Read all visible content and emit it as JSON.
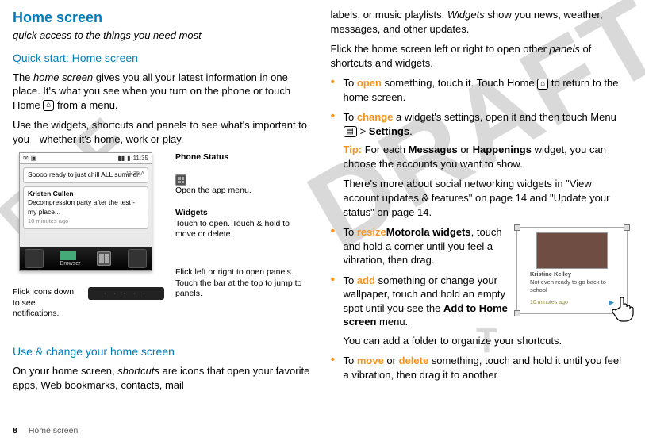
{
  "left": {
    "title": "Home screen",
    "subtitle": "quick access to the things you need most",
    "section1": "Quick start: Home screen",
    "p1a": "The ",
    "p1em": "home screen",
    "p1b": " gives you all your latest information in one place. It's what you see when you turn on the phone or touch Home ",
    "p1c": " from a menu.",
    "p2": "Use the widgets, shortcuts and panels to see what's important to you—whether it's home, work or play.",
    "phone": {
      "time": "11:35",
      "card1": "Soooo ready to just chill ALL summer!",
      "card1time": "11:35 A",
      "card2name": "Kristen Cullen",
      "card2text": "Decompression party after the test - my place...",
      "card2time": "10 minutes ago",
      "browser": "Browser"
    },
    "callouts": {
      "phonestatus": "Phone Status",
      "apptray_text": "Open the app menu.",
      "widgets_title": "Widgets",
      "widgets_text": "Touch to open. Touch & hold to move or delete.",
      "flickicons": "Flick icons down to see notifications.",
      "flickpanels": "Flick left or right to open panels. Touch the bar at the top to jump to panels."
    },
    "section2": "Use & change your home screen",
    "p3a": "On your home screen, ",
    "p3em": "shortcuts",
    "p3b": " are icons that open your favorite apps, Web bookmarks, contacts, mail "
  },
  "right": {
    "p1a": "labels, or music playlists. ",
    "p1em": "Widgets",
    "p1b": " show you news, weather, messages, and other updates.",
    "p2a": "Flick the home screen left or right to open other ",
    "p2em": "panels",
    "p2b": " of shortcuts and widgets.",
    "bul_open_kw": "open",
    "bul_open_a": "To ",
    "bul_open_b": " something, touch it. Touch Home ",
    "bul_open_c": " to return to the home screen.",
    "bul_change_kw": "change",
    "bul_change_a": "To ",
    "bul_change_b": " a widget's settings, open it and then touch Menu ",
    "bul_change_c": " > ",
    "bul_change_settings": "Settings",
    "bul_change_dot": ".",
    "tip_label": "Tip:",
    "tip_a": " For each ",
    "tip_msg": "Messages",
    "tip_or": " or ",
    "tip_hap": "Happenings",
    "tip_b": " widget, you can choose the accounts you want to show.",
    "tip_more": "There's more about social networking widgets in \"View account updates & features\" on page 14 and \"Update your status\" on page 14.",
    "bul_resize_kw": "resize",
    "bul_resize_bold": "Motorola widgets",
    "bul_resize_a": "To ",
    "bul_resize_b": ", touch and hold a corner until you feel a vibration, then drag.",
    "bul_add_kw": "add",
    "bul_add_a": "To ",
    "bul_add_b": " something or change your wallpaper, touch and hold an empty spot until you see the ",
    "bul_add_menu": "Add to Home screen",
    "bul_add_c": " menu.",
    "bul_add_folder": "You can add a folder to organize your shortcuts.",
    "bul_move_kw": "move",
    "bul_move_or": " or ",
    "bul_delete_kw": "delete",
    "bul_move_a": "To ",
    "bul_move_b": " something, touch and hold it until you feel a vibration, then drag it to another",
    "mini": {
      "name": "Kristine Kelley",
      "text": "Not even ready to go back to school",
      "time": "10 minutes ago"
    }
  },
  "footer": {
    "page": "8",
    "label": "Home screen"
  }
}
